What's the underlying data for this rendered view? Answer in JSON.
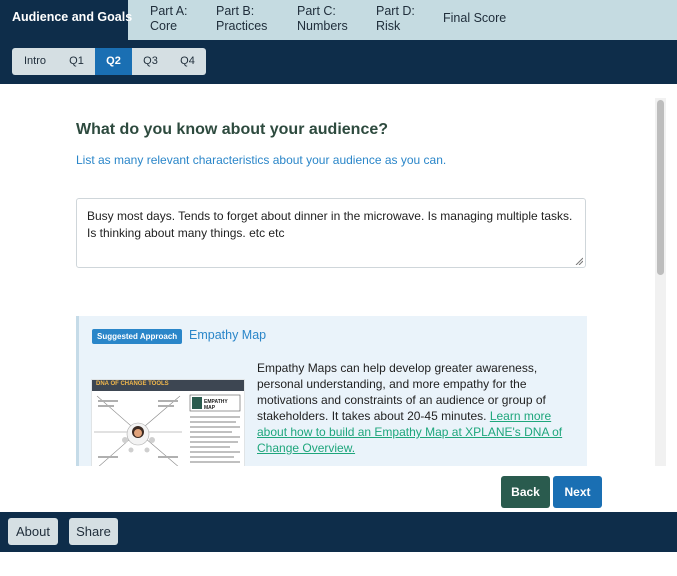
{
  "top_tabs": [
    {
      "lines": [
        "Audience and Goals"
      ],
      "active": true
    },
    {
      "lines": [
        "Part A:",
        "Core"
      ],
      "active": false
    },
    {
      "lines": [
        "Part B:",
        "Practices"
      ],
      "active": false
    },
    {
      "lines": [
        "Part C:",
        "Numbers"
      ],
      "active": false
    },
    {
      "lines": [
        "Part D:",
        "Risk"
      ],
      "active": false
    },
    {
      "lines": [
        "Final Score"
      ],
      "active": false
    }
  ],
  "question_nav": [
    "Intro",
    "Q1",
    "Q2",
    "Q3",
    "Q4"
  ],
  "question_nav_active": "Q2",
  "question": {
    "title": "What do you know about your audience?",
    "subtitle": "List as many relevant characteristics about your audience as you can.",
    "answer": "Busy most days. Tends to forget about dinner in the microwave. Is managing multiple tasks. Is thinking about many things. etc etc"
  },
  "approach": {
    "badge": "Suggested Approach",
    "title": "Empathy Map",
    "text": "Empathy Maps can help develop greater awareness, personal understanding, and more empathy for the motivations and constraints of an audience or group of stakeholders. It takes about 20-45 minutes. ",
    "link": "Learn more about how to build an Empathy Map at XPLANE's DNA of Change Overview.",
    "image_title": "DNA OF CHANGE TOOLS",
    "image_label": "EMPATHY MAP"
  },
  "buttons": {
    "back": "Back",
    "next": "Next"
  },
  "footer": {
    "about": "About",
    "share": "Share"
  },
  "colors": {
    "nav_dark": "#0e2d4a",
    "tab_light": "#c5dbe1",
    "accent_blue": "#1a6fb3",
    "back_green": "#2a5b4e",
    "link_green": "#1ea67c"
  }
}
